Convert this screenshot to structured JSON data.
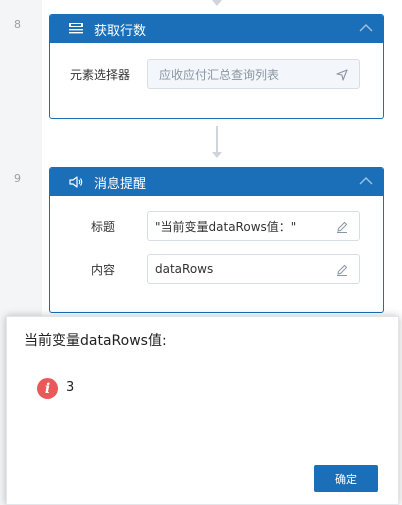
{
  "steps": [
    {
      "number": "8",
      "title": "获取行数",
      "icon": "ssp-table-icon",
      "fields": [
        {
          "label": "元素选择器",
          "value": "应收应付汇总查询列表",
          "icon": "locate-arrow-icon",
          "readonly": true
        }
      ]
    },
    {
      "number": "9",
      "title": "消息提醒",
      "icon": "speaker-icon",
      "fields": [
        {
          "label": "标题",
          "value": "\"当前变量dataRows值：\"",
          "icon": "edit-pencil-icon",
          "readonly": false
        },
        {
          "label": "内容",
          "value": "dataRows",
          "icon": "edit-pencil-icon",
          "readonly": false
        }
      ]
    }
  ],
  "dialog": {
    "title": "当前变量dataRows值:",
    "message": "3",
    "ok_label": "确定",
    "icon": "info-icon"
  },
  "colors": {
    "accent": "#1a6fb8",
    "info_icon": "#e85a5a"
  }
}
